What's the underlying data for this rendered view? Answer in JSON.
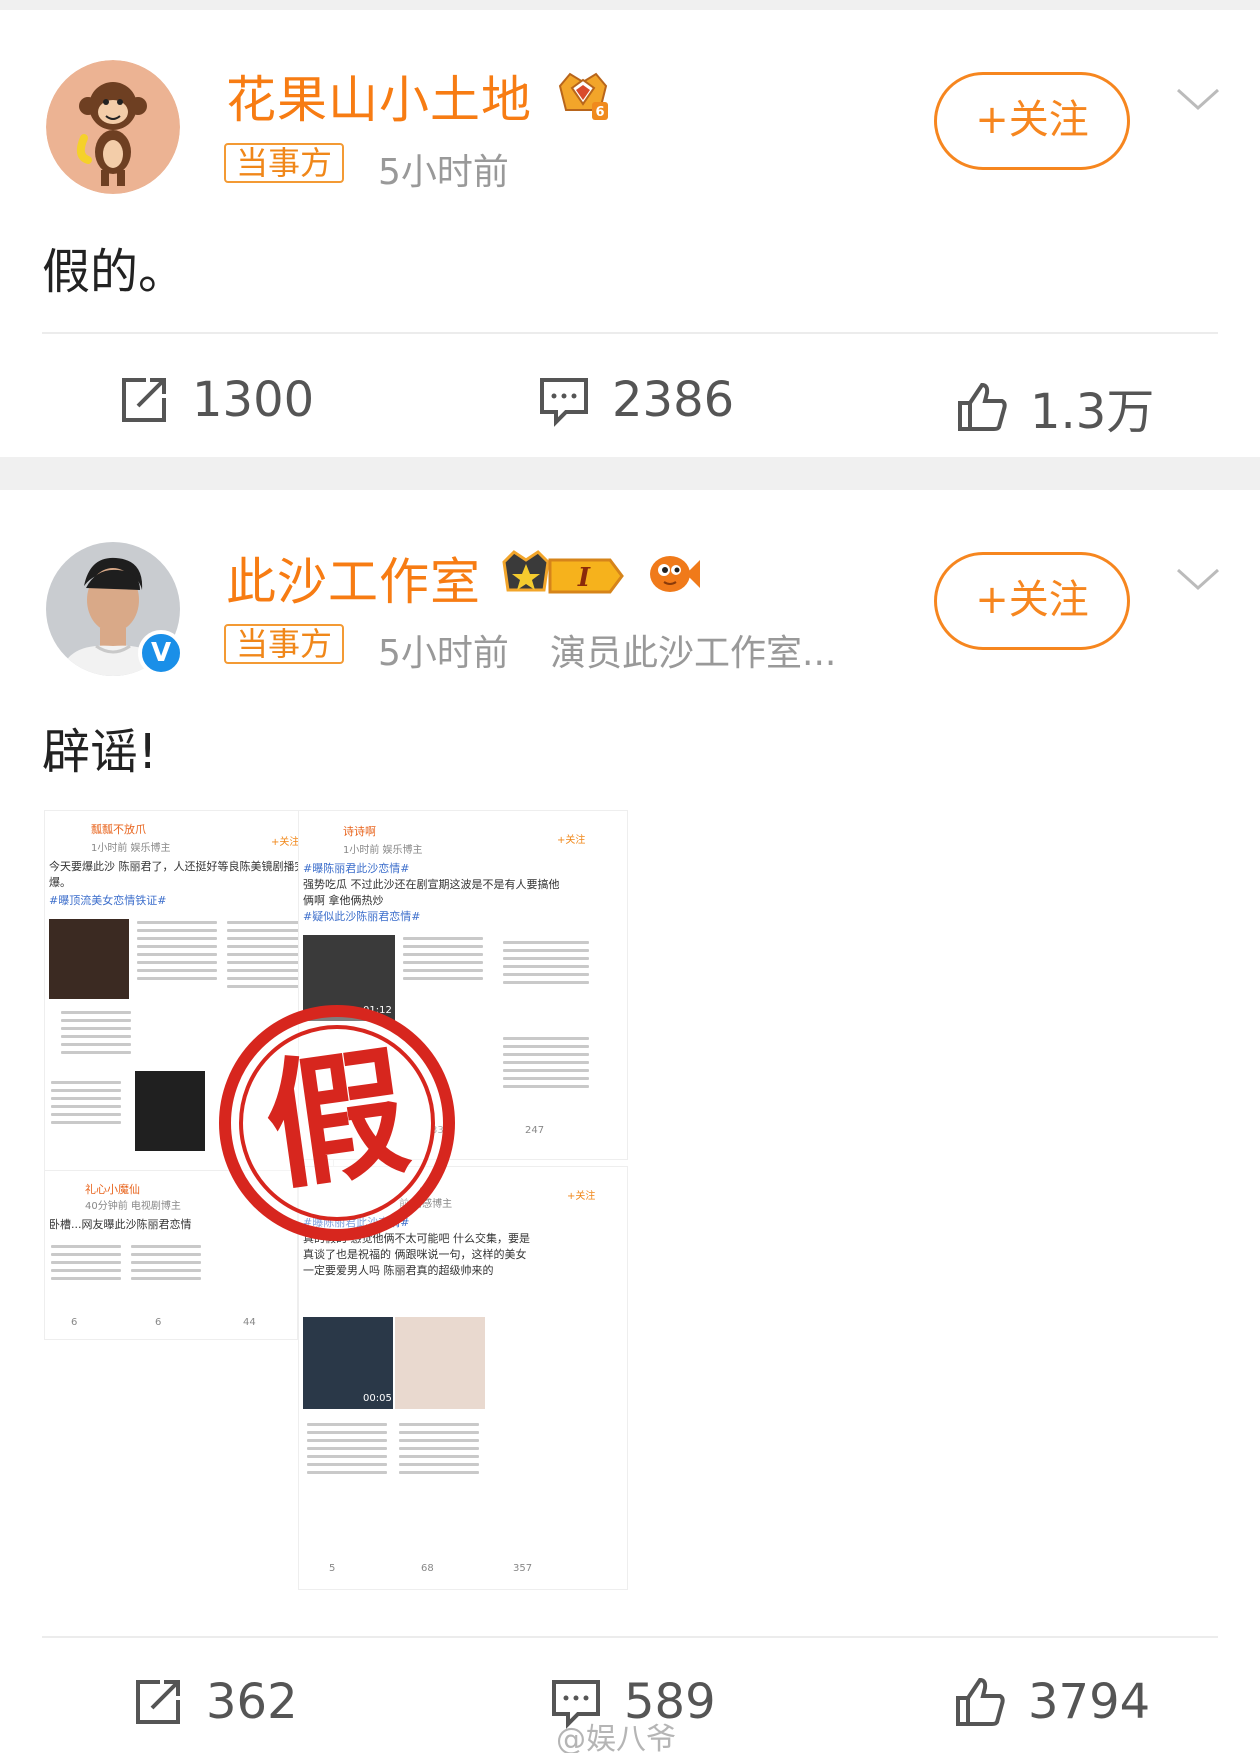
{
  "posts": [
    {
      "username": "花果山小土地",
      "party_badge": "当事方",
      "time": "5小时前",
      "source": "",
      "follow_label": "+关注",
      "text": "假的。",
      "reposts": "1300",
      "comments": "2386",
      "likes": "1.3万",
      "avatar_icon": "monkey-avatar-icon",
      "level_badge": "6"
    },
    {
      "username": "此沙工作室",
      "party_badge": "当事方",
      "time": "5小时前",
      "source": "演员此沙工作室...",
      "follow_label": "+关注",
      "text": "辟谣!",
      "reposts": "362",
      "comments": "589",
      "likes": "3794",
      "avatar_icon": "person-avatar-icon",
      "verified_mark": "V",
      "level_badge": "I"
    }
  ],
  "collage": {
    "stamp_char": "假",
    "items": [
      {
        "name": "瓢瓢不放爪",
        "meta": "1小时前 娱乐博主",
        "text": "今天要爆此沙 陈丽君了，人还挺好等良陈美镜剧播完才爆。",
        "tag": "#曝顶流美女恋情铁证#",
        "follow": "+关注"
      },
      {
        "name": "诗诗啊",
        "meta": "1小时前 娱乐博主",
        "tag": "#曝陈丽君此沙恋情#",
        "text": "强势吃瓜 不过此沙还在剧宣期这波是不是有人要搞他俩啊 拿他俩热炒",
        "tag2": "#疑似此沙陈丽君恋情#",
        "follow": "+关注",
        "video_time": "01:12",
        "comments": "33",
        "likes": "247"
      },
      {
        "name": "礼心小魔仙",
        "meta": "40分钟前 电视剧博主",
        "text": "卧槽...网友曝此沙陈丽君恋情",
        "reposts": "6",
        "comments": "6",
        "likes": "44"
      },
      {
        "name": "...",
        "meta": "前 情感博主",
        "tag": "#曝陈丽君此沙恋情#",
        "text": "真的假的 感觉他俩不太可能吧 什么交集，要是真谈了也是祝福的 俩跟咪说一句，这样的美女一定要爱男人吗 陈丽君真的超级帅来的",
        "follow": "+关注",
        "video_time": "00:05",
        "reposts": "5",
        "comments": "68",
        "likes": "357"
      }
    ]
  },
  "watermark": "@娱八爷",
  "colors": {
    "accent": "#f6861f",
    "username": "#f77c13",
    "verified": "#1a8fe8",
    "stamp": "#d7261e"
  }
}
